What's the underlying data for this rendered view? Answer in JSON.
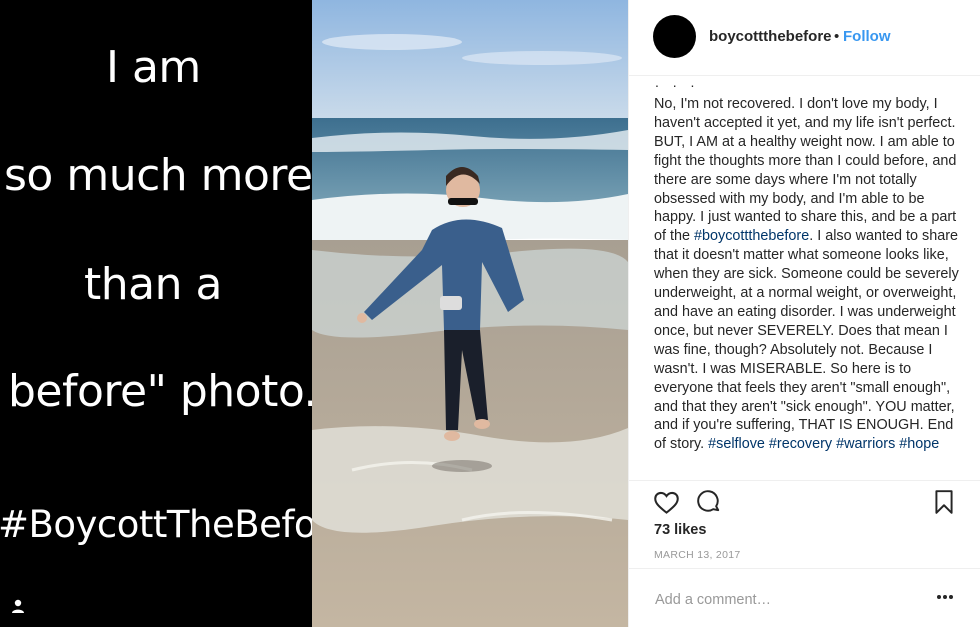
{
  "image_text": {
    "line1": "I am",
    "line2": "so much more",
    "line3": "than a",
    "line4": "before\" photo.",
    "line5": "#BoycottTheBefore"
  },
  "post": {
    "username": "boycottthebefore",
    "separator": "•",
    "follow_label": "Follow",
    "caption_dots": ". . .",
    "caption_part1": "No, I'm not recovered. I don't love my body, I haven't accepted it yet, and my life isn't perfect. BUT, I AM at a healthy weight now. I am able to fight the thoughts more than I could before, and there are some days where I'm not totally obsessed with my body, and I'm able to be happy. I just wanted to share this, and be a part of the ",
    "caption_tag1": "#boycottthebefore",
    "caption_part2": ". I also wanted to share that it doesn't matter what someone looks like, when they are sick. Someone could be severely underweight, at a normal weight, or overweight, and have an eating disorder. I was underweight once, but never SEVERELY. Does that mean I was fine, though? Absolutely not. Because I wasn't. I was MISERABLE. So here is to everyone that feels they aren't \"small enough\", and that they aren't \"sick enough\". YOU matter, and if you're suffering, THAT IS ENOUGH. End of story. ",
    "hashtags": [
      "#selflove",
      "#recovery",
      "#warriors",
      "#hope"
    ],
    "likes": "73 likes",
    "date": "MARCH 13, 2017",
    "comment_placeholder": "Add a comment…"
  },
  "colors": {
    "follow": "#3897f0",
    "hashtag": "#003569",
    "text": "#262626",
    "muted": "#999999"
  },
  "icons": [
    "user-tag-icon",
    "heart-icon",
    "comment-icon",
    "bookmark-icon",
    "more-icon"
  ]
}
